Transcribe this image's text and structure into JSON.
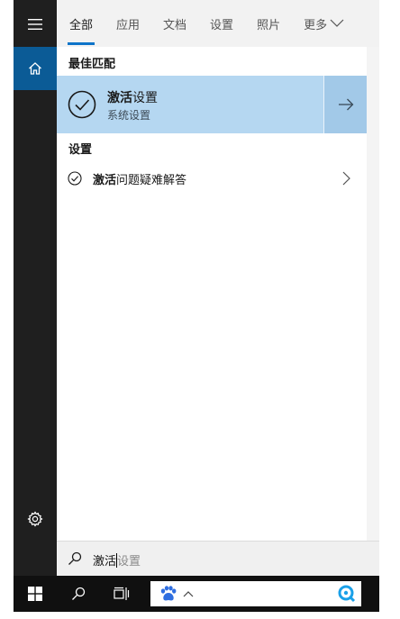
{
  "rail": {
    "menu_icon": "hamburger-icon",
    "home_icon": "home-icon",
    "settings_icon": "gear-icon"
  },
  "tabs": [
    {
      "label": "全部",
      "active": true
    },
    {
      "label": "应用",
      "active": false
    },
    {
      "label": "文档",
      "active": false
    },
    {
      "label": "设置",
      "active": false
    },
    {
      "label": "照片",
      "active": false
    },
    {
      "label": "更多",
      "active": false
    }
  ],
  "best_match": {
    "section_label": "最佳匹配",
    "title_bold": "激活",
    "title_rest": "设置",
    "subtitle": "系统设置",
    "icon": "check-circle-icon",
    "open_icon": "arrow-right-icon"
  },
  "settings_section": {
    "section_label": "设置",
    "items": [
      {
        "bold": "激活",
        "rest": "问题疑难解答",
        "icon": "check-circle-icon"
      }
    ]
  },
  "search": {
    "typed": "激活",
    "suggestion": "设置"
  },
  "taskbar": {
    "start_icon": "windows-logo-icon",
    "search_icon": "search-icon",
    "taskview_icon": "task-view-icon",
    "paw_icon": "baidu-paw-icon",
    "chevron_icon": "chevron-up-icon",
    "search_app_icon": "baidu-search-icon"
  },
  "colors": {
    "accent": "#0e74c9",
    "home_active": "#0b5b96",
    "best_match_bg": "#b5d7f1",
    "best_match_arrow_bg": "#a2c9e8",
    "rail_bg": "#1f1f1f",
    "taskbar_bg": "#101010"
  }
}
